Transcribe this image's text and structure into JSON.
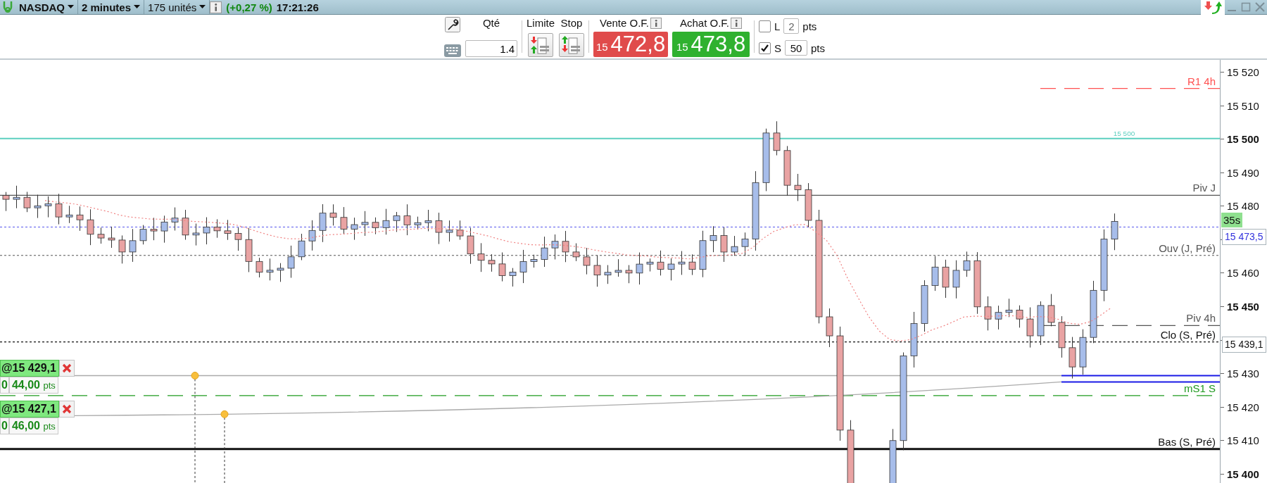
{
  "top_bar": {
    "instrument": "NASDAQ",
    "timeframe": "2 minutes",
    "units": "175 unités",
    "change": "(+0,27 %)",
    "time": "17:21:26"
  },
  "order_panel": {
    "quantity_label": "Qté",
    "quantity": "1.4",
    "limit_label": "Limite",
    "stop_label": "Stop",
    "quotes": [
      {
        "kind": "sell",
        "label": "Vente O.F.",
        "big_figure": "15",
        "price": "472,8"
      },
      {
        "kind": "buy",
        "label": "Achat O.F.",
        "big_figure": "15",
        "price": "473,8"
      }
    ],
    "offsets": [
      {
        "label": "L",
        "checked": false,
        "value": "2",
        "unit": "pts"
      },
      {
        "label": "S",
        "checked": true,
        "value": "50",
        "unit": "pts"
      }
    ]
  },
  "chart": {
    "levels": [
      {
        "label": "R1 4h",
        "kind": "dashed",
        "color": "#ff5050"
      },
      {
        "label": "15 500",
        "kind": "round",
        "color": "#5ccfbf"
      },
      {
        "label": "Piv J",
        "kind": "solid",
        "color": "#555555"
      },
      {
        "label": "Ouv (J, Pré)",
        "kind": "dotted",
        "color": "#555555"
      },
      {
        "label": "Piv 4h",
        "kind": "dashed",
        "color": "#555555"
      },
      {
        "label": "Clo (S, Pré)",
        "kind": "dotted",
        "color": "#111111"
      },
      {
        "label": "mS1 S",
        "kind": "dashed",
        "color": "#1f9a1f"
      },
      {
        "label": "Bas (S, Pré)",
        "kind": "thick",
        "color": "#111111"
      }
    ],
    "price_axis": [
      {
        "label": "15 520",
        "bold": false
      },
      {
        "label": "15 510",
        "bold": false
      },
      {
        "label": "15 500",
        "bold": true
      },
      {
        "label": "15 490",
        "bold": false
      },
      {
        "label": "15 480",
        "bold": false
      },
      {
        "label": "15 460",
        "bold": false
      },
      {
        "label": "15 450",
        "bold": true
      },
      {
        "label": "15 430",
        "bold": false
      },
      {
        "label": "15 420",
        "bold": false
      },
      {
        "label": "15 410",
        "bold": false
      },
      {
        "label": "15 400",
        "bold": true
      }
    ],
    "markers": [
      {
        "kind": "timer",
        "label": "35s"
      },
      {
        "kind": "last",
        "label": "15 473,5"
      },
      {
        "kind": "level",
        "label": "15 439,1"
      }
    ],
    "orders": [
      {
        "price": "@15 429,1",
        "quantity": "0",
        "distance": "44,00",
        "unit": "pts"
      },
      {
        "price": "@15 427,1",
        "quantity": "0",
        "distance": "46,00",
        "unit": "pts"
      }
    ]
  }
}
